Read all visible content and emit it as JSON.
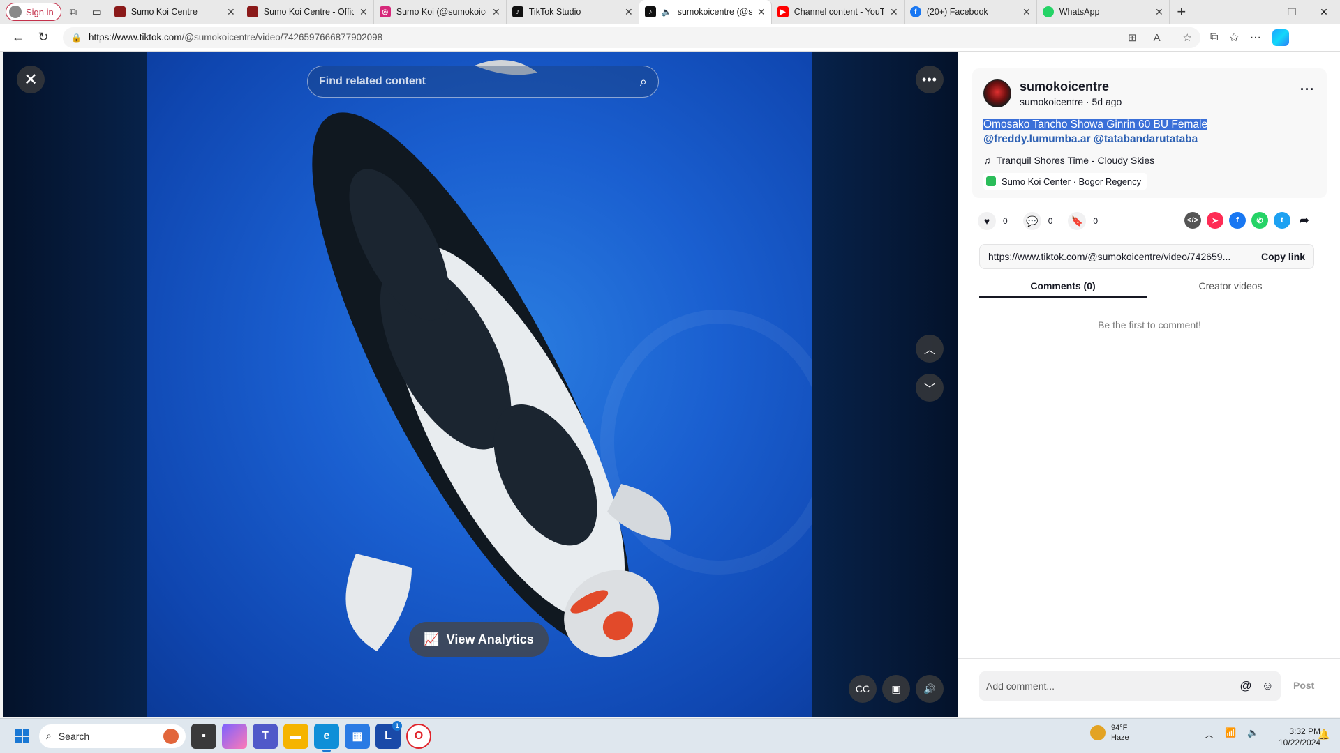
{
  "browser": {
    "signin_label": "Sign in",
    "tabs": [
      {
        "title": "Sumo Koi Centre",
        "favicon": "sumo-koi-favicon",
        "color": "#8b1a1a"
      },
      {
        "title": "Sumo Koi Centre - Offici",
        "favicon": "sumo-koi-favicon",
        "color": "#8b1a1a"
      },
      {
        "title": "Sumo Koi (@sumokoice",
        "favicon": "instagram-icon",
        "color": "#d6287a"
      },
      {
        "title": "TikTok Studio",
        "favicon": "tiktok-icon",
        "color": "#111111"
      },
      {
        "title": "sumokoicentre (@s",
        "favicon": "tiktok-icon",
        "color": "#111111"
      },
      {
        "title": "Channel content - YouTu",
        "favicon": "youtube-icon",
        "color": "#ff0000"
      },
      {
        "title": "(20+) Facebook",
        "favicon": "facebook-icon",
        "color": "#1877f2"
      },
      {
        "title": "WhatsApp",
        "favicon": "whatsapp-icon",
        "color": "#25d366"
      }
    ],
    "url_domain": "https://www.tiktok.com",
    "url_path": "/@sumokoicentre/video/7426597666877902098"
  },
  "video": {
    "search_placeholder": "Find related content",
    "analytics_label": "View Analytics"
  },
  "post": {
    "username": "sumokoicentre",
    "sub": "sumokoicentre · 5d ago",
    "caption": "Omosako Tancho Showa Ginrin 60 BU Female",
    "tags": "@freddy.lumumba.ar @tatabandarutataba",
    "music": "Tranquil Shores Time - Cloudy Skies",
    "location": "Sumo Koi Center · Bogor Regency",
    "likes": "0",
    "comments": "0",
    "saves": "0",
    "link": "https://www.tiktok.com/@sumokoicentre/video/742659...",
    "copy_link_label": "Copy link",
    "tab_comments": "Comments (0)",
    "tab_creator": "Creator videos",
    "empty_text": "Be the first to comment!",
    "comment_placeholder": "Add comment...",
    "post_label": "Post"
  },
  "taskbar": {
    "search_label": "Search",
    "weather_temp": "94°F",
    "weather_desc": "Haze",
    "time": "3:32 PM",
    "date": "10/22/2024",
    "badge_count": "1"
  }
}
